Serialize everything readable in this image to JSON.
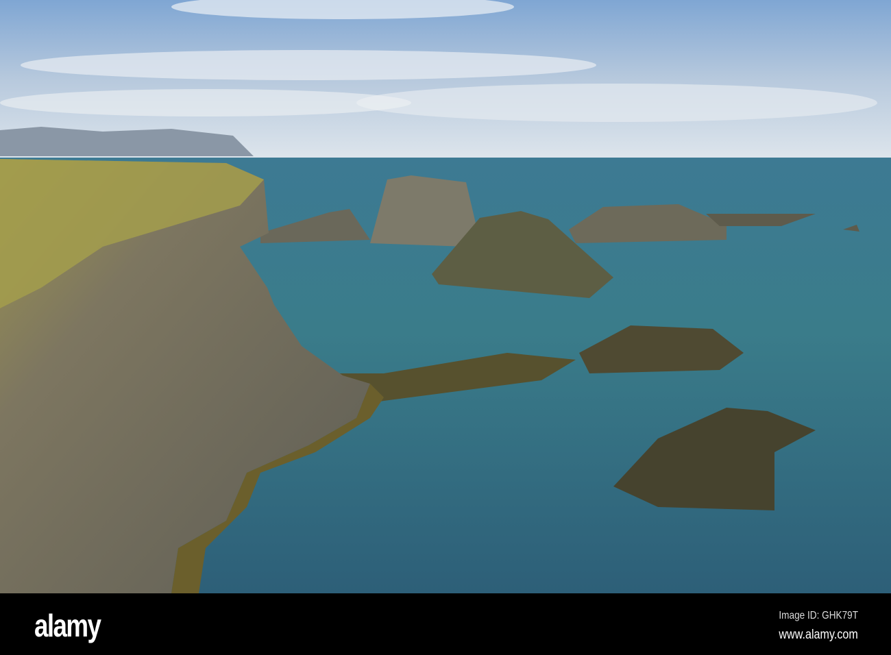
{
  "footer": {
    "logo": "alamy",
    "image_id": "Image ID: GHK79T",
    "url": "www.alamy.com"
  },
  "colors": {
    "sky_top": "#7fa6d3",
    "sky_horizon": "#dbe4ec",
    "sea": "#2f6f86",
    "cliff": "#6b6a5c",
    "grass": "#a8a14a"
  }
}
